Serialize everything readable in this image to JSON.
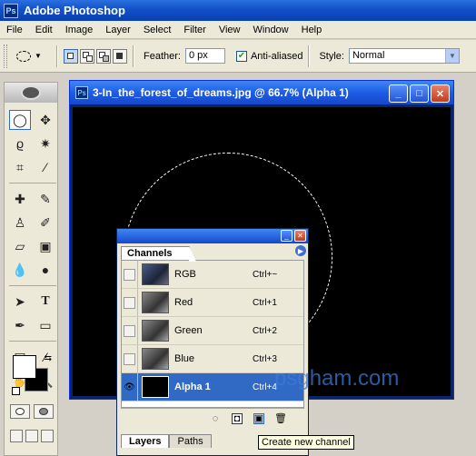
{
  "app": {
    "title": "Adobe Photoshop"
  },
  "menu": [
    "File",
    "Edit",
    "Image",
    "Layer",
    "Select",
    "Filter",
    "View",
    "Window",
    "Help"
  ],
  "options": {
    "feather_label": "Feather:",
    "feather_value": "0 px",
    "antialias_label": "Anti-aliased",
    "antialias_checked": true,
    "style_label": "Style:",
    "style_value": "Normal"
  },
  "document": {
    "title": "3-In_the_forest_of_dreams.jpg @ 66.7% (Alpha 1)"
  },
  "channels_panel": {
    "tab": "Channels",
    "rows": [
      {
        "name": "RGB",
        "shortcut": "Ctrl+~",
        "visible": false
      },
      {
        "name": "Red",
        "shortcut": "Ctrl+1",
        "visible": false
      },
      {
        "name": "Green",
        "shortcut": "Ctrl+2",
        "visible": false
      },
      {
        "name": "Blue",
        "shortcut": "Ctrl+3",
        "visible": false
      },
      {
        "name": "Alpha 1",
        "shortcut": "Ctrl+4",
        "visible": true,
        "selected": true
      }
    ],
    "bottom_tabs": [
      "Layers",
      "Paths"
    ]
  },
  "tooltip": "Create new channel",
  "watermark": "psgham.com",
  "colors": {
    "titlebar": "#1e5ce6",
    "selected_row": "#316ac5",
    "canvas": "#000000"
  }
}
